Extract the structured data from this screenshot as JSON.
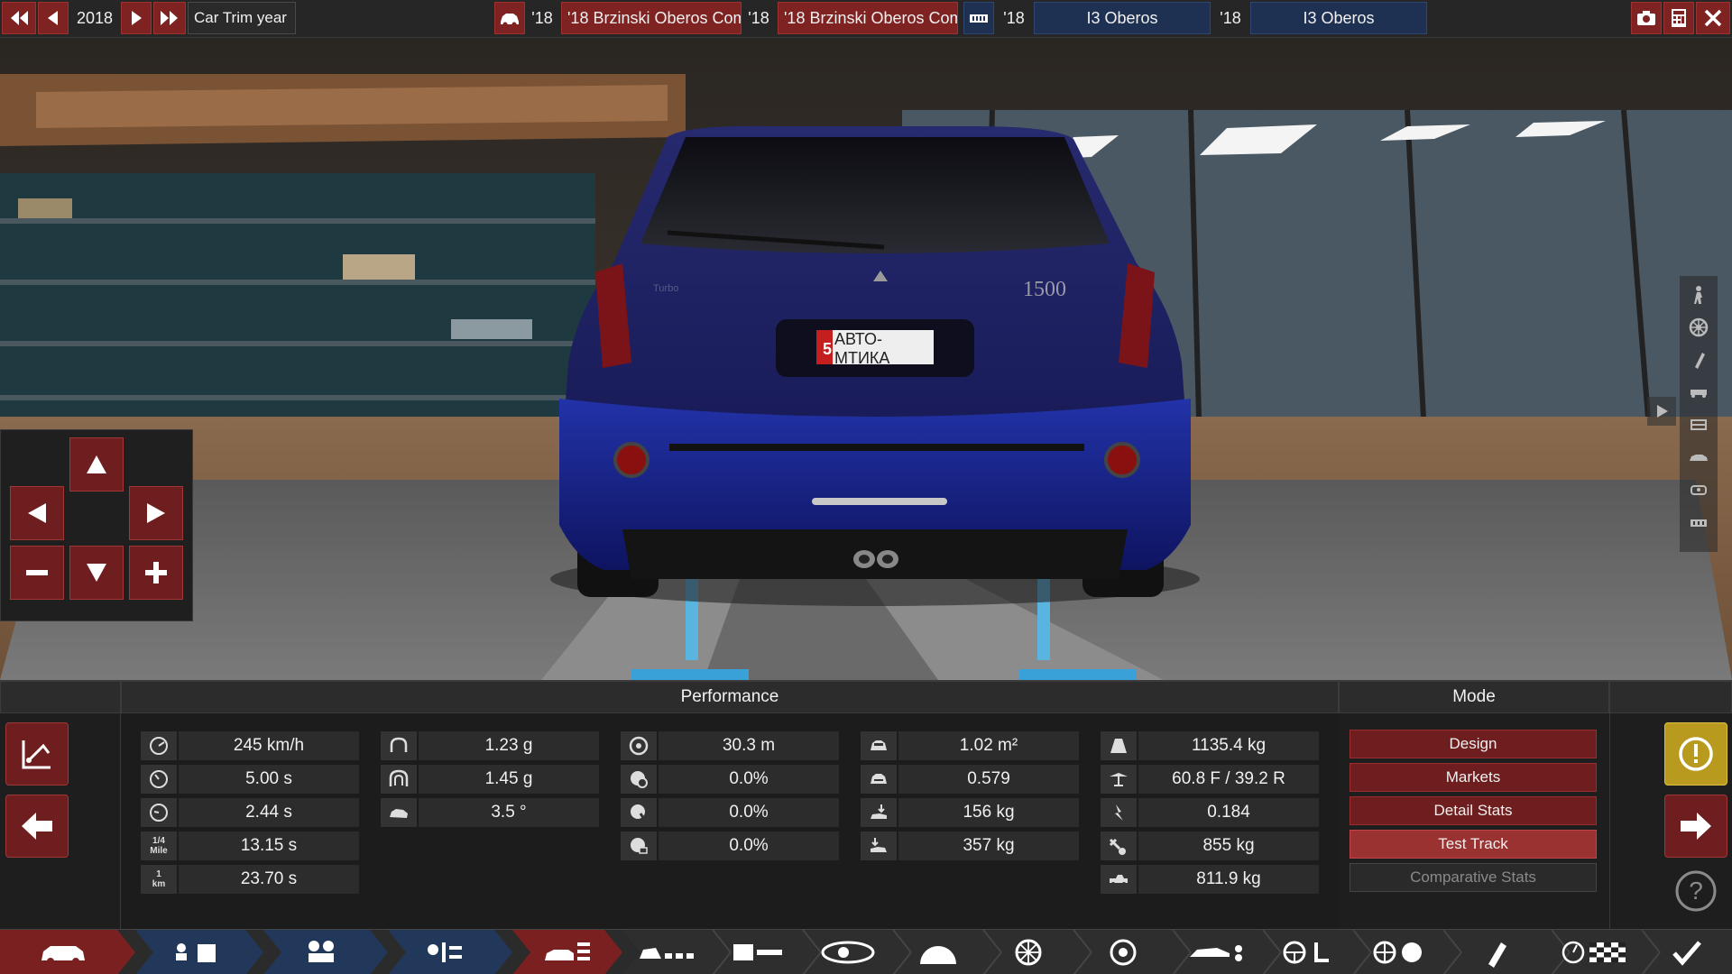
{
  "topbar": {
    "year": "2018",
    "label": "Car Trim year",
    "model_year_a": "'18",
    "model_name_a": "'18 Brzinski Oberos Com",
    "trim_year_a": "'18",
    "trim_name_a": "'18 Brzinski Oberos Com",
    "engine_year_a": "'18",
    "engine_name_a": "I3 Oberos",
    "engine_year_b": "'18",
    "engine_name_b": "I3 Oberos"
  },
  "scene": {
    "plate_number": "5",
    "plate_text": "АВТО-МТИКА",
    "badge_left": "Turbo",
    "badge_right": "1500"
  },
  "performance": {
    "title": "Performance",
    "col1": [
      {
        "icon": "top-speed-icon",
        "value": "245 km/h"
      },
      {
        "icon": "acceleration-100-icon",
        "value": "5.00 s"
      },
      {
        "icon": "acceleration-60-icon",
        "value": "2.44 s"
      },
      {
        "icon": "quarter-mile-icon",
        "label_top": "1/4",
        "label_bottom": "Mile",
        "value": "13.15 s"
      },
      {
        "icon": "one-km-icon",
        "label_top": "1",
        "label_bottom": "km",
        "value": "23.70 s"
      }
    ],
    "col2": [
      {
        "icon": "cornering-grip-icon",
        "value": "1.23 g"
      },
      {
        "icon": "max-cornering-icon",
        "value": "1.45 g"
      },
      {
        "icon": "body-roll-icon",
        "value": "3.5 °"
      }
    ],
    "col3": [
      {
        "icon": "braking-distance-icon",
        "value": "30.3 m"
      },
      {
        "icon": "brake-fade-icon",
        "value": "0.0%"
      },
      {
        "icon": "brake-fade-2-icon",
        "value": "0.0%"
      },
      {
        "icon": "brake-fade-3-icon",
        "value": "0.0%"
      }
    ],
    "col4": [
      {
        "icon": "frontal-area-icon",
        "value": "1.02 m²"
      },
      {
        "icon": "drag-coefficient-icon",
        "value": "0.579"
      },
      {
        "icon": "front-downforce-icon",
        "value": "156 kg"
      },
      {
        "icon": "rear-downforce-icon",
        "value": "357 kg"
      }
    ],
    "col5": [
      {
        "icon": "weight-icon",
        "value": "1135.4 kg"
      },
      {
        "icon": "weight-distribution-icon",
        "value": "60.8 F / 39.2 R"
      },
      {
        "icon": "weight-ratio-icon",
        "value": "0.184"
      },
      {
        "icon": "towing-capacity-icon",
        "value": "855 kg"
      },
      {
        "icon": "cargo-weight-icon",
        "value": "811.9 kg"
      }
    ]
  },
  "mode": {
    "title": "Mode",
    "buttons": [
      "Design",
      "Markets",
      "Detail Stats",
      "Test Track",
      "Comparative Stats"
    ],
    "active": "Test Track"
  },
  "colors": {
    "accent_red": "#6e1e1e",
    "active_red": "#9a3232",
    "nav_blue": "#243a5e",
    "warning_yellow": "#b89a1e",
    "car_body": "#1c1f6e"
  }
}
